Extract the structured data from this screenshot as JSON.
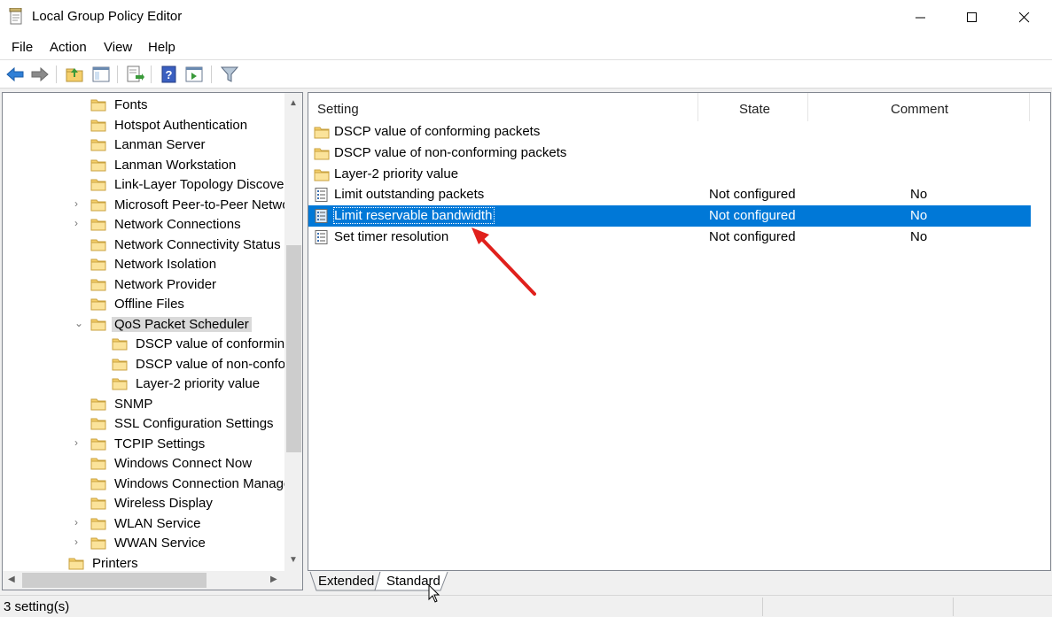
{
  "window": {
    "title": "Local Group Policy Editor"
  },
  "menu": {
    "items": [
      "File",
      "Action",
      "View",
      "Help"
    ]
  },
  "toolbar": {
    "buttons": [
      "back-icon",
      "forward-icon",
      "up-folder-icon",
      "show-hide-tree-icon",
      "export-list-icon",
      "help-icon",
      "show-hide-action-pane-icon",
      "filter-icon"
    ]
  },
  "tree": {
    "items": [
      {
        "label": "Fonts",
        "level": 1,
        "expandable": false,
        "selected": false
      },
      {
        "label": "Hotspot Authentication",
        "level": 1,
        "expandable": false,
        "selected": false
      },
      {
        "label": "Lanman Server",
        "level": 1,
        "expandable": false,
        "selected": false
      },
      {
        "label": "Lanman Workstation",
        "level": 1,
        "expandable": false,
        "selected": false
      },
      {
        "label": "Link-Layer Topology Discovery",
        "level": 1,
        "expandable": false,
        "selected": false
      },
      {
        "label": "Microsoft Peer-to-Peer Networking Services",
        "level": 1,
        "expandable": true,
        "selected": false
      },
      {
        "label": "Network Connections",
        "level": 1,
        "expandable": true,
        "selected": false
      },
      {
        "label": "Network Connectivity Status Indicator",
        "level": 1,
        "expandable": false,
        "selected": false
      },
      {
        "label": "Network Isolation",
        "level": 1,
        "expandable": false,
        "selected": false
      },
      {
        "label": "Network Provider",
        "level": 1,
        "expandable": false,
        "selected": false
      },
      {
        "label": "Offline Files",
        "level": 1,
        "expandable": false,
        "selected": false
      },
      {
        "label": "QoS Packet Scheduler",
        "level": 1,
        "expandable": true,
        "expanded": true,
        "selected": true
      },
      {
        "label": "DSCP value of conforming packets",
        "level": 2,
        "expandable": false,
        "selected": false
      },
      {
        "label": "DSCP value of non-conforming packets",
        "level": 2,
        "expandable": false,
        "selected": false
      },
      {
        "label": "Layer-2 priority value",
        "level": 2,
        "expandable": false,
        "selected": false
      },
      {
        "label": "SNMP",
        "level": 1,
        "expandable": false,
        "selected": false
      },
      {
        "label": "SSL Configuration Settings",
        "level": 1,
        "expandable": false,
        "selected": false
      },
      {
        "label": "TCPIP Settings",
        "level": 1,
        "expandable": true,
        "selected": false
      },
      {
        "label": "Windows Connect Now",
        "level": 1,
        "expandable": false,
        "selected": false
      },
      {
        "label": "Windows Connection Manager",
        "level": 1,
        "expandable": false,
        "selected": false
      },
      {
        "label": "Wireless Display",
        "level": 1,
        "expandable": false,
        "selected": false
      },
      {
        "label": "WLAN Service",
        "level": 1,
        "expandable": true,
        "selected": false
      },
      {
        "label": "WWAN Service",
        "level": 1,
        "expandable": true,
        "selected": false
      },
      {
        "label": "Printers",
        "level": 0,
        "expandable": false,
        "selected": false
      }
    ]
  },
  "list": {
    "columns": [
      "Setting",
      "State",
      "Comment"
    ],
    "rows": [
      {
        "icon": "folder-icon",
        "name": "DSCP value of conforming packets",
        "state": "",
        "comment": "",
        "selected": false
      },
      {
        "icon": "folder-icon",
        "name": "DSCP value of non-conforming packets",
        "state": "",
        "comment": "",
        "selected": false
      },
      {
        "icon": "folder-icon",
        "name": "Layer-2 priority value",
        "state": "",
        "comment": "",
        "selected": false
      },
      {
        "icon": "policy-setting-icon",
        "name": "Limit outstanding packets",
        "state": "Not configured",
        "comment": "No",
        "selected": false
      },
      {
        "icon": "policy-setting-icon",
        "name": "Limit reservable bandwidth",
        "state": "Not configured",
        "comment": "No",
        "selected": true
      },
      {
        "icon": "policy-setting-icon",
        "name": "Set timer resolution",
        "state": "Not configured",
        "comment": "No",
        "selected": false
      }
    ]
  },
  "tabs": {
    "items": [
      "Extended",
      "Standard"
    ],
    "active": "Standard"
  },
  "status": {
    "text": "3 setting(s)"
  },
  "colors": {
    "selection": "#0078d7",
    "annotation_arrow": "#e0201c",
    "folder": "#f5cf6b"
  }
}
